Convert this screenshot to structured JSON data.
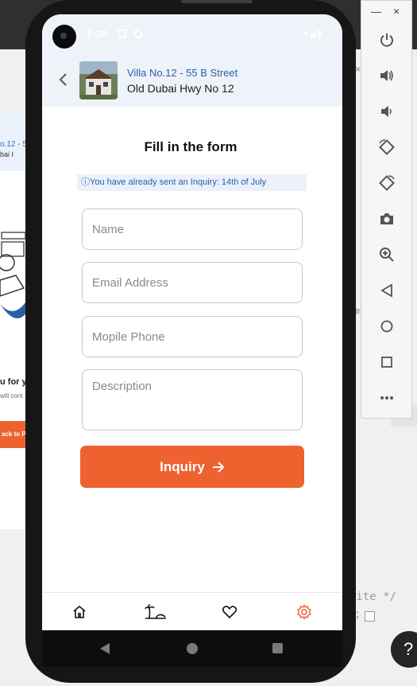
{
  "background_app": {
    "card_title": "o.12 - 55",
    "card_subtitle": "bai I",
    "thanks_text": "u for y",
    "small_text": "will cont",
    "back_button": "ack to P",
    "code_line_1": "nite */",
    "code_line_2": ";",
    "help_label": "?",
    "right_fragment_a": "×",
    "right_fragment_b": "x",
    "right_fragment_c": "ex"
  },
  "status_bar": {
    "time": "7:28",
    "right_icons": "▾◢▮"
  },
  "header": {
    "title": "Villa No.12 - 55 B Street",
    "subtitle": "Old Dubai Hwy No 12"
  },
  "form": {
    "heading": "Fill in the form",
    "notice": "ⓘYou have already sent an Inquiry: 14th of July",
    "name_placeholder": "Name",
    "email_placeholder": "Email Address",
    "phone_placeholder": "Mopile Phone",
    "description_placeholder": "Description",
    "submit_label": "Inquiry"
  },
  "bottom_nav": {
    "items": [
      "home-icon",
      "beach-icon",
      "heart-icon",
      "settings-icon"
    ],
    "active_color": "#ee6230"
  },
  "emulator_toolbar": {
    "minimize_label": "—",
    "close_label": "×",
    "buttons": [
      "power-icon",
      "volume-up-icon",
      "volume-down-icon",
      "rotate-left-icon",
      "rotate-right-icon",
      "camera-icon",
      "zoom-icon",
      "back-icon",
      "home-icon",
      "overview-icon",
      "more-icon"
    ]
  },
  "colors": {
    "accent": "#ee6230",
    "link_blue": "#2a5da6",
    "header_bg": "#eef3fa"
  }
}
